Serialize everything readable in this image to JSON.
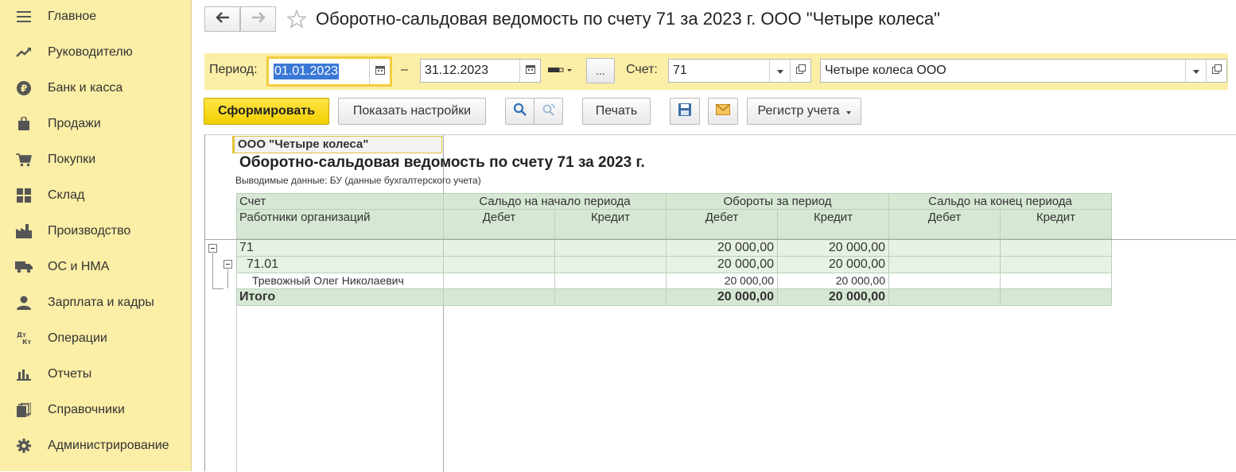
{
  "sidebar": {
    "items": [
      {
        "label": "Главное",
        "icon": "menu-icon"
      },
      {
        "label": "Руководителю",
        "icon": "trend-icon"
      },
      {
        "label": "Банк и касса",
        "icon": "ruble-icon"
      },
      {
        "label": "Продажи",
        "icon": "shopping-bag-icon"
      },
      {
        "label": "Покупки",
        "icon": "cart-icon"
      },
      {
        "label": "Склад",
        "icon": "warehouse-icon"
      },
      {
        "label": "Производство",
        "icon": "factory-icon"
      },
      {
        "label": "ОС и НМА",
        "icon": "truck-icon"
      },
      {
        "label": "Зарплата и кадры",
        "icon": "person-icon"
      },
      {
        "label": "Операции",
        "icon": "dt-kt-icon"
      },
      {
        "label": "Отчеты",
        "icon": "bar-chart-icon"
      },
      {
        "label": "Справочники",
        "icon": "books-icon"
      },
      {
        "label": "Администрирование",
        "icon": "gear-icon"
      }
    ]
  },
  "header": {
    "title": "Оборотно-сальдовая ведомость по счету 71 за 2023 г. ООО \"Четыре колеса\""
  },
  "filters": {
    "period_label": "Период:",
    "period_start": "01.01.2023",
    "dash": "–",
    "period_end": "31.12.2023",
    "period_picker_label": "...",
    "account_label": "Счет:",
    "account_value": "71",
    "org_value": "Четыре колеса ООО"
  },
  "toolbar": {
    "generate": "Сформировать",
    "show_settings": "Показать настройки",
    "print": "Печать",
    "register": "Регистр учета"
  },
  "report": {
    "org_name": "ООО \"Четыре колеса\"",
    "title": "Оборотно-сальдовая ведомость по счету 71 за 2023 г.",
    "output_data": "Выводимые данные: БУ (данные бухгалтерского учета)",
    "headers": {
      "account": "Счет",
      "employees": "Работники организаций",
      "opening_balance": "Сальдо на начало периода",
      "turnover": "Обороты за период",
      "closing_balance": "Сальдо на конец периода",
      "debit": "Дебет",
      "credit": "Кредит"
    },
    "rows": [
      {
        "name": "71",
        "open_dt": "",
        "open_kt": "",
        "turn_dt": "20 000,00",
        "turn_kt": "20 000,00",
        "close_dt": "",
        "close_kt": ""
      },
      {
        "name": "71.01",
        "open_dt": "",
        "open_kt": "",
        "turn_dt": "20 000,00",
        "turn_kt": "20 000,00",
        "close_dt": "",
        "close_kt": ""
      },
      {
        "name": "Тревожный Олег Николаевич",
        "open_dt": "",
        "open_kt": "",
        "turn_dt": "20 000,00",
        "turn_kt": "20 000,00",
        "close_dt": "",
        "close_kt": ""
      }
    ],
    "total": {
      "name": "Итого",
      "turn_dt": "20 000,00",
      "turn_kt": "20 000,00"
    }
  },
  "colors": {
    "sidebar_bg": "#fbeea6",
    "primary_button": "#f5d400",
    "table_header": "#d6e8d3",
    "table_row": "#e6f2e4"
  }
}
